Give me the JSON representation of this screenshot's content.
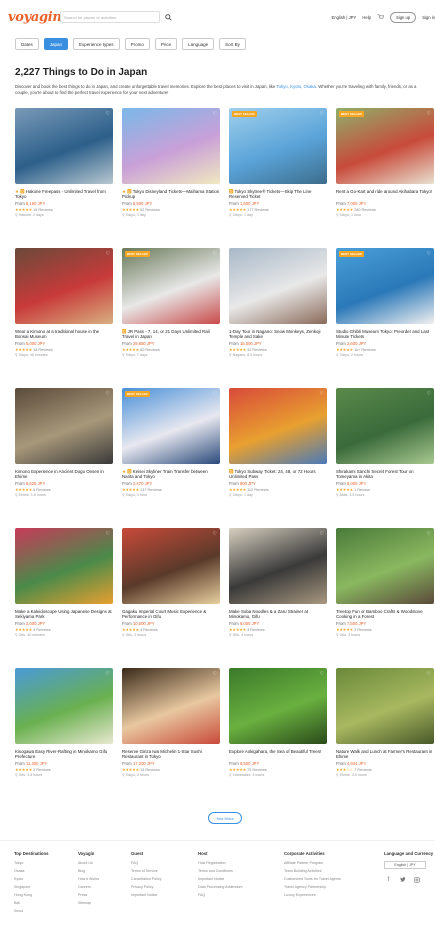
{
  "header": {
    "logo": "voyagin",
    "search_placeholder": "Search for places or activities",
    "language_currency": "English | JPY",
    "help": "Help",
    "signup": "Sign up",
    "signin": "Sign in"
  },
  "filters": [
    "Dates",
    "Japan",
    "Experience types",
    "Promo",
    "Price",
    "Language",
    "Sort By"
  ],
  "page_title": "2,227 Things to Do in Japan",
  "intro": {
    "text_before": "Discover and book the best things to do in Japan, and create unforgettable travel memories. Explore the best places to visit in Japan, like ",
    "links": "Tokyo, Kyoto, Osaka",
    "text_after": ". Whether you're traveling with family, friends, or as a couple, you're about to find the perfect travel experience for your next adventure!"
  },
  "cards": [
    {
      "prefix": "★ 🅾 ",
      "title": "Hakone Freepass - Unlimited Travel from Tokyo",
      "price": "8,150 JPY",
      "stars": "★★★★★",
      "reviews": "16 Reviews",
      "meta": "Hakone, 2 days",
      "badge": "",
      "colors": [
        "#7a9ab8",
        "#2c5f8a",
        "#b8c8d0"
      ]
    },
    {
      "prefix": "★ 🅾 ",
      "title": "Tokyo Disneyland Tickets—Maihama Station Pickup",
      "price": "8,500 JPY",
      "stars": "★★★★★",
      "reviews": "52 Reviews",
      "meta": "Tokyo, 1 day",
      "badge": "",
      "colors": [
        "#7ab8e8",
        "#c9a0d8",
        "#f0e8c0"
      ]
    },
    {
      "prefix": "🅾 ",
      "title": "Tokyo Skytree® Tickets—Skip The Line Reserved Ticket",
      "price": "1,600 JPY",
      "stars": "★★★★★",
      "reviews": "177 Reviews",
      "meta": "Tokyo, 1 day",
      "badge": "BEST SELLER",
      "colors": [
        "#9fcfec",
        "#5aa3d8",
        "#3d6d8c"
      ]
    },
    {
      "prefix": "",
      "title": "Rent a Go-Kart and ride around Akihabara Tokyo!",
      "price": "7,000 JPY",
      "stars": "★★★★★",
      "reviews": "280 Reviews",
      "meta": "Tokyo, 1 hour",
      "badge": "BEST SELLER",
      "colors": [
        "#8fb06a",
        "#c84a3a",
        "#e8e0d0"
      ]
    },
    {
      "prefix": "",
      "title": "Wear a Kimono at a traditional house in the Bonsai Museum",
      "price": "5,000 JPY",
      "stars": "★★★★★",
      "reviews": "18 Reviews",
      "meta": "Tokyo, 45 minutes",
      "badge": "",
      "colors": [
        "#6a4a3a",
        "#c83a3a",
        "#d8b080"
      ]
    },
    {
      "prefix": "🅾 ",
      "title": "JR Pass - 7, 14, or 21 Days Unlimited Rail Travel in Japan",
      "price": "29,650 JPY",
      "stars": "★★★★★",
      "reviews": "60 Reviews",
      "meta": "Tokyo, 7 days",
      "badge": "BEST SELLER",
      "colors": [
        "#6a7a5a",
        "#e8e8e8",
        "#c84a4a"
      ]
    },
    {
      "prefix": "",
      "title": "1-Day Tour in Nagano: Snow Monkeys, Zenkoji Temple and Sake",
      "price": "15,500 JPY",
      "stars": "★★★★★",
      "reviews": "32 Reviews",
      "meta": "Nagano, 8.5 hours",
      "badge": "",
      "colors": [
        "#a8b8c8",
        "#e8e8e8",
        "#8a6a5a"
      ]
    },
    {
      "prefix": "",
      "title": "Studio Ghibli Museum Tokyo: Preorder and Last Minute Tickets",
      "price": "2,600 JPY",
      "stars": "★★★★★",
      "reviews": "1k+ Reviews",
      "meta": "Tokyo, 2 hours",
      "badge": "BEST SELLER",
      "colors": [
        "#4aa0d8",
        "#2a78b8",
        "#f0f0f0"
      ]
    },
    {
      "prefix": "",
      "title": "Kimono Experience in Ancient Dogo Onsen in Ehime",
      "price": "8,625 JPY",
      "stars": "★★★★★",
      "reviews": "6 Reviews",
      "meta": "Ehime, 1.5 hours",
      "badge": "",
      "colors": [
        "#5a4a3a",
        "#a8987a",
        "#3a3a3a"
      ]
    },
    {
      "prefix": "★ 🅾 ",
      "title": "Keisei Skyliner Train Transfer between Narita and Tokyo",
      "price": "2,470 JPY",
      "stars": "★★★★★",
      "reviews": "137 Reviews",
      "meta": "Tokyo, 1 hour",
      "badge": "BEST SELLER",
      "colors": [
        "#4a90d8",
        "#e8e8f0",
        "#2a4a7a"
      ]
    },
    {
      "prefix": "🅾 ",
      "title": "Tokyo Subway Ticket: 24, 48, or 72 Hours Unlimited Pass",
      "price": "800 JPY",
      "stars": "★★★★★",
      "reviews": "112 Reviews",
      "meta": "Tokyo, 1 day",
      "badge": "",
      "colors": [
        "#d84a3a",
        "#e8a030",
        "#4a7ab8"
      ]
    },
    {
      "prefix": "",
      "title": "Shirakami Sanchi Secret Forest Tour on Tomeyama in Akita",
      "price": "8,000 JPY",
      "stars": "★★★★★",
      "reviews": "1 Review",
      "meta": "Akita, 3.5 hours",
      "badge": "",
      "colors": [
        "#5a8a4a",
        "#3a6a3a",
        "#a8c890"
      ]
    },
    {
      "prefix": "",
      "title": "Make a Kaleidoscope Using Japanese Designs at Sekiyama Park",
      "price": "2,000 JPY",
      "stars": "★★★★★",
      "reviews": "3 Reviews",
      "meta": "Gifu, 40 minutes",
      "badge": "",
      "colors": [
        "#c83a5a",
        "#4a8a4a",
        "#e8a030"
      ]
    },
    {
      "prefix": "",
      "title": "Gagaku Imperial Court Music Experience & Performance in Gifu",
      "price": "10,000 JPY",
      "stars": "★★★★★",
      "reviews": "3 Reviews",
      "meta": "Gifu, 2 hours",
      "badge": "",
      "colors": [
        "#c84a3a",
        "#5a3a2a",
        "#e8d0a0"
      ]
    },
    {
      "prefix": "",
      "title": "Make Soba Noodles & a Zaru Strainer at Minokamo, Gifu",
      "price": "6,000 JPY",
      "stars": "★★★★★",
      "reviews": "3 Reviews",
      "meta": "Gifu, 4 hours",
      "badge": "",
      "colors": [
        "#d8d0c0",
        "#3a3a3a",
        "#a89880"
      ]
    },
    {
      "prefix": "",
      "title": "Treetop Fun or Bamboo Crafts & Woodstove Cooking in a Forest",
      "price": "7,500 JPY",
      "stars": "★★★★★",
      "reviews": "3 Reviews",
      "meta": "Gifu, 3 hours",
      "badge": "",
      "colors": [
        "#4a7a3a",
        "#8ab860",
        "#5a4a3a"
      ]
    },
    {
      "prefix": "",
      "title": "Kisogawa Easy River-Rafting in Minokamo Gifu Prefecture",
      "price": "11,300 JPY",
      "stars": "★★★★★",
      "reviews": "2 Reviews",
      "meta": "Gifu, 3.5 hours",
      "badge": "",
      "colors": [
        "#4a9ad8",
        "#6ab050",
        "#e8e8d0"
      ]
    },
    {
      "prefix": "",
      "title": "Reserve Ginza Iwa Michelin 1-Star Sushi Restaurant in Tokyo",
      "price": "17,200 JPY",
      "stars": "★★★★★",
      "reviews": "13 Reviews",
      "meta": "Tokyo, 2 hours",
      "badge": "",
      "colors": [
        "#3a2a1a",
        "#e8c8a0",
        "#c84a3a"
      ]
    },
    {
      "prefix": "",
      "title": "Explore Aokigahara, the Sea of Beautiful Trees!",
      "price": "6,500 JPY",
      "stars": "★★★★★",
      "reviews": "75 Reviews",
      "meta": "Yamanashi, 3 hours",
      "badge": "",
      "colors": [
        "#3a7a2a",
        "#6ab040",
        "#2a4a1a"
      ]
    },
    {
      "prefix": "",
      "title": "Nature Walk and Lunch at Farmer's Restaurant in Ehime",
      "price": "4,944 JPY",
      "stars": "★★★☆☆",
      "reviews": "7 Reviews",
      "meta": "Ehime, 3.5 hours",
      "badge": "",
      "colors": [
        "#6a8a3a",
        "#a8b860",
        "#4a5a2a"
      ]
    }
  ],
  "price_prefix": "From ",
  "see_more": "See More",
  "footer": {
    "cols": [
      {
        "heading": "Top Destinations",
        "items": [
          "Tokyo",
          "Osaka",
          "Kyoto",
          "Singapore",
          "Hong Kong",
          "Bali",
          "Seoul"
        ]
      },
      {
        "heading": "Voyagin",
        "items": [
          "About Us",
          "Blog",
          "How it Works",
          "Careers",
          "Press",
          "Sitemap"
        ]
      },
      {
        "heading": "Guest",
        "items": [
          "FAQ",
          "Terms of Service",
          "Cancellation Policy",
          "Privacy Policy",
          "Important Notice"
        ]
      },
      {
        "heading": "Host",
        "items": [
          "Host Registration",
          "Terms and Conditions",
          "Important Notice",
          "Data Processing Addendum",
          "FAQ"
        ]
      },
      {
        "heading": "Corporate Activities",
        "items": [
          "Affiliate Partner Program",
          "Team Building Activities",
          "Customized Tours for Travel Agents",
          "Travel Agency Partnership",
          "Luxury Experiences"
        ]
      }
    ],
    "lang_heading": "Language and Currency",
    "lang_value": "English | JPY"
  }
}
